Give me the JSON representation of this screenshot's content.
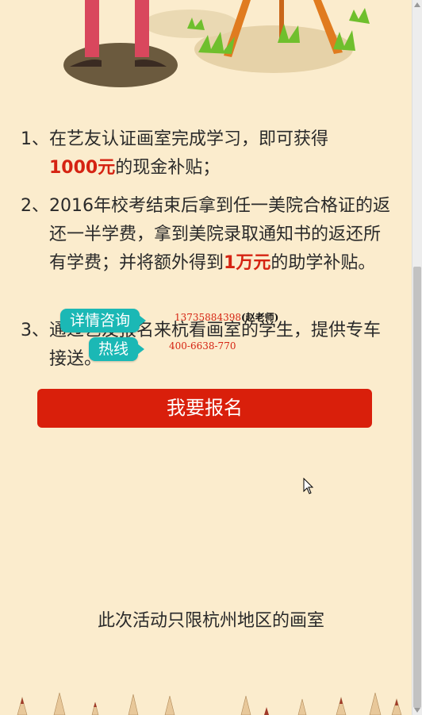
{
  "benefits": [
    {
      "num": "1、",
      "text_before": "在艺友认证画室完成学习，即可获得",
      "line2_highlight": "1000元",
      "line2_after": "的现金补贴；"
    },
    {
      "num": "2、",
      "text_before": "2016年校考结束后拿到任一美院合格证的返还一半学费，拿到美院录取通知书的返还所有学费；并将额外得到",
      "highlight": "1万元",
      "text_after": "的助学补贴。"
    },
    {
      "num": "3、",
      "text": "通过艺友报名来杭看画室的学生，提供专车接送。"
    }
  ],
  "consult": {
    "consult_label": "详情咨询",
    "hotline_label": "热线",
    "phone_mobile": "13735884398",
    "contact_name": "(赵老师)",
    "phone_landline": "400-6638-770"
  },
  "cta": {
    "label": "我要报名"
  },
  "footer": {
    "note": "此次活动只限杭州地区的画室"
  },
  "colors": {
    "background": "#fbeccd",
    "accent_red": "#d91f0b",
    "consult_teal": "#1bb8b5"
  },
  "icons": {
    "cursor": "pointer-arrow-icon"
  }
}
